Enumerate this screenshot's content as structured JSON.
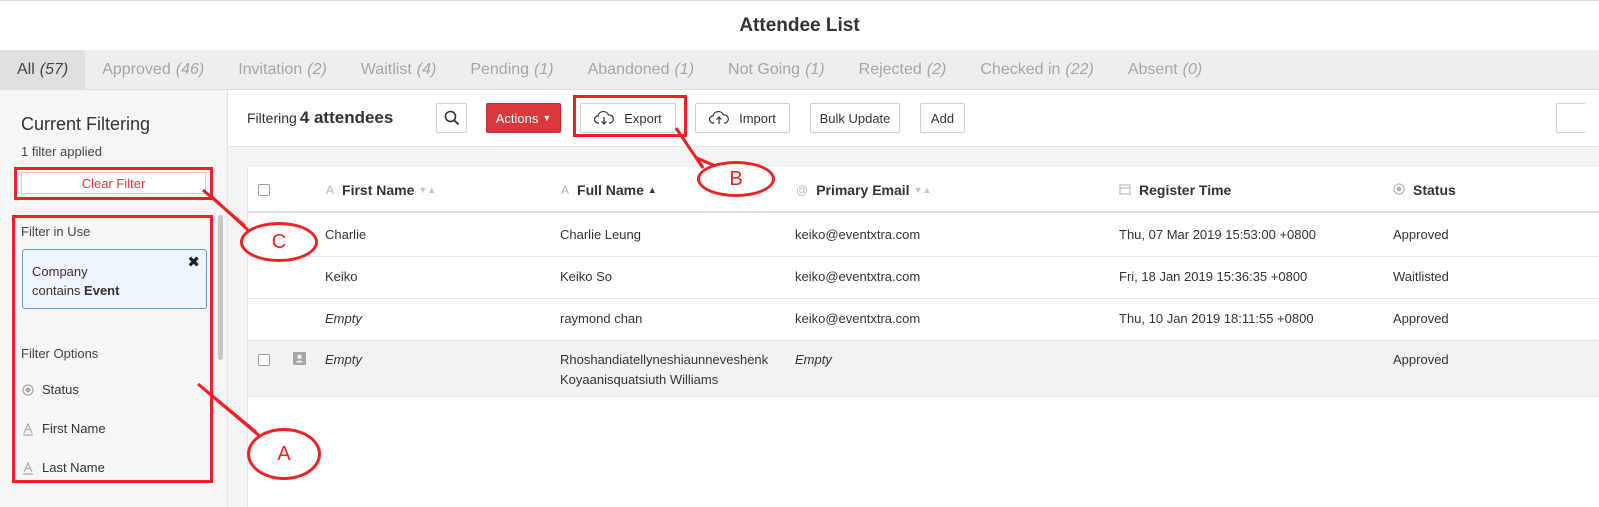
{
  "page": {
    "title": "Attendee List"
  },
  "tabs": [
    {
      "label": "All",
      "count": "(57)"
    },
    {
      "label": "Approved",
      "count": "(46)"
    },
    {
      "label": "Invitation",
      "count": "(2)"
    },
    {
      "label": "Waitlist",
      "count": "(4)"
    },
    {
      "label": "Pending",
      "count": "(1)"
    },
    {
      "label": "Abandoned",
      "count": "(1)"
    },
    {
      "label": "Not Going",
      "count": "(1)"
    },
    {
      "label": "Rejected",
      "count": "(2)"
    },
    {
      "label": "Checked in",
      "count": "(22)"
    },
    {
      "label": "Absent",
      "count": "(0)"
    }
  ],
  "sidebar": {
    "title": "Current Filtering",
    "subtitle": "1 filter applied",
    "clear_label": "Clear Filter",
    "in_use_label": "Filter in Use",
    "filter": {
      "field": "Company",
      "operator": "contains",
      "value": "Event"
    },
    "options_label": "Filter Options",
    "options": [
      {
        "label": "Status",
        "icon": "radio-icon"
      },
      {
        "label": "First Name",
        "icon": "text-icon"
      },
      {
        "label": "Last Name",
        "icon": "text-icon"
      }
    ]
  },
  "toolbar": {
    "filtering_label": "Filtering",
    "filtering_count": "4 attendees",
    "actions_label": "Actions",
    "export_label": "Export",
    "import_label": "Import",
    "bulk_update_label": "Bulk Update",
    "add_label": "Add"
  },
  "table": {
    "columns": {
      "first_name": "First Name",
      "full_name": "Full Name",
      "email": "Primary Email",
      "register": "Register Time",
      "status": "Status"
    },
    "rows": [
      {
        "first": "Charlie",
        "full": "Charlie Leung",
        "email": "keiko@eventxtra.com",
        "register": "Thu, 07 Mar 2019 15:53:00 +0800",
        "status": "Approved"
      },
      {
        "first": "Keiko",
        "full": "Keiko So",
        "email": "keiko@eventxtra.com",
        "register": "Fri, 18 Jan 2019 15:36:35 +0800",
        "status": "Waitlisted"
      },
      {
        "first": "Empty",
        "full": "raymond chan",
        "email": "keiko@eventxtra.com",
        "register": "Thu, 10 Jan 2019 18:11:55 +0800",
        "status": "Approved"
      },
      {
        "first": "Empty",
        "full": "Rhoshandiatellyneshiaunneveshenk Koyaanisquatsiuth Williams",
        "email": "Empty",
        "register": "",
        "status": "Approved"
      }
    ]
  },
  "annotations": {
    "a": "A",
    "b": "B",
    "c": "C"
  },
  "colors": {
    "accent_red": "#d9383f",
    "annotation_red": "#ee2222",
    "filter_border": "#5b9bd5"
  }
}
